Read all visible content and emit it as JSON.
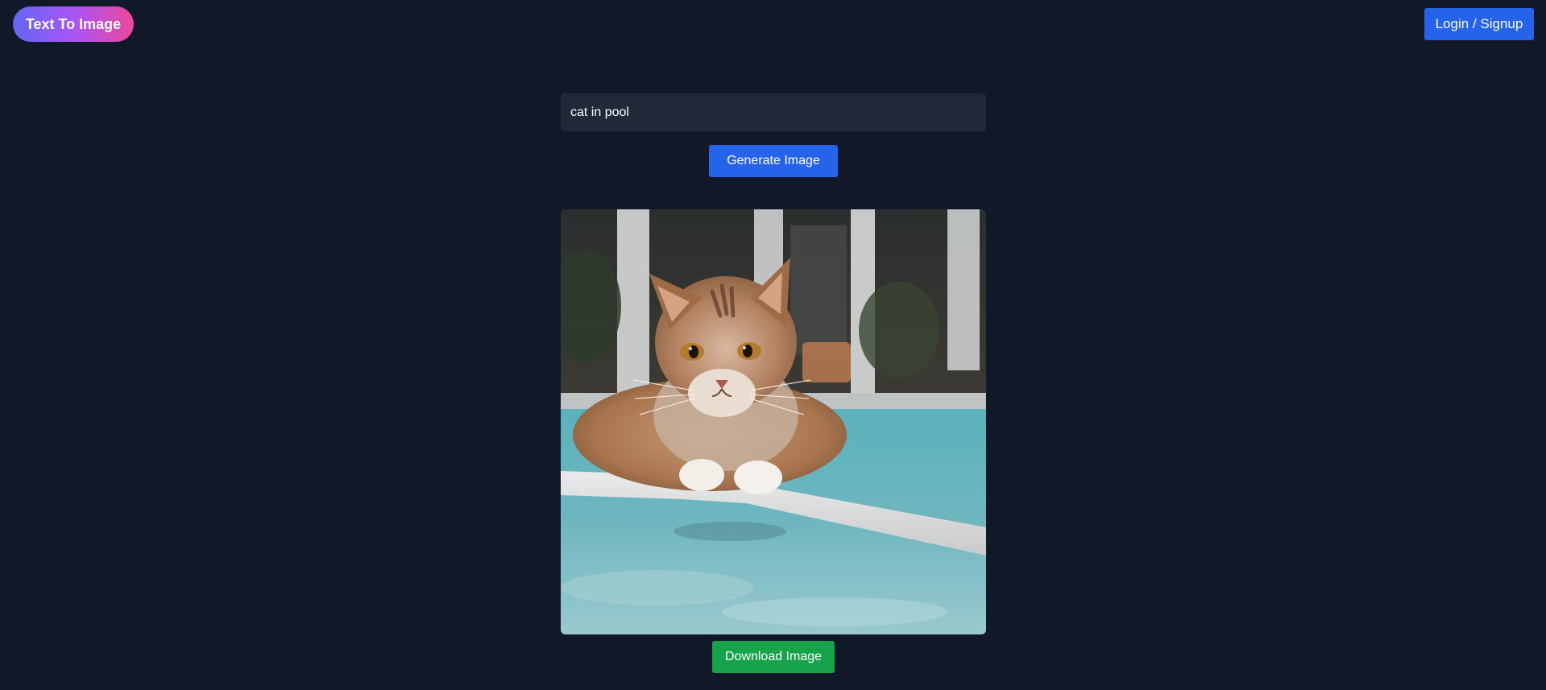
{
  "header": {
    "logo_label": "Text To Image",
    "login_label": "Login / Signup"
  },
  "prompt": {
    "value": "cat in pool"
  },
  "actions": {
    "generate_label": "Generate Image",
    "download_label": "Download Image"
  },
  "colors": {
    "background": "#111827",
    "input_bg": "#1f2937",
    "primary": "#2563eb",
    "success": "#16a34a",
    "logo_gradient_start": "#6366f1",
    "logo_gradient_end": "#ec4899"
  }
}
